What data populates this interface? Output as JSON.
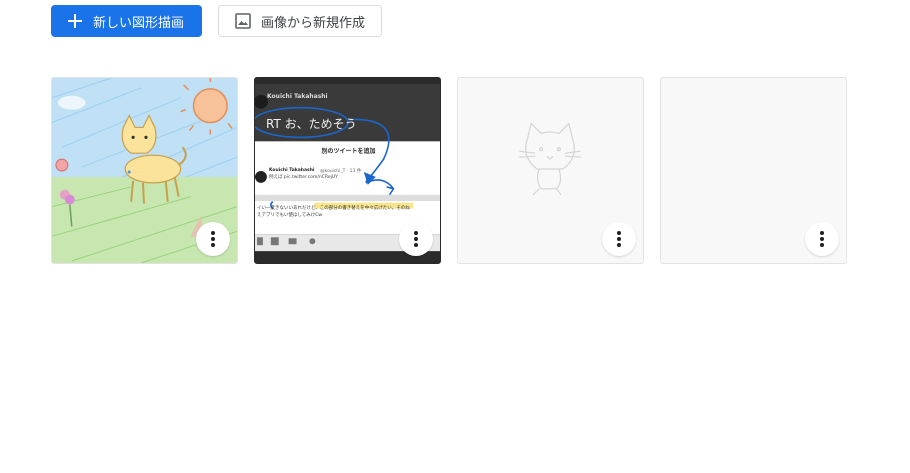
{
  "toolbar": {
    "new_drawing_label": "新しい図形描画",
    "new_from_image_label": "画像から新規作成"
  },
  "drawings": [
    {
      "kind": "crayon-cat-sketch"
    },
    {
      "kind": "tweet-screenshot-annotation",
      "tweet_author": "Kouichi Takahashi",
      "tweet_text": "RT お、ためそう",
      "dialog_title": "別のツイートを追加",
      "reply_author": "Kouichi Takahashi",
      "reply_handle": "@kouichi_T · 13 件",
      "reply_text": "例えば pic.twitter.com/nCRejUY",
      "body_text_1": "イい一度きないいあれだけど、この部分の書き替えを中々広げたい。そのね",
      "body_text_2": "えアプリでもい使ほしてみけCw"
    },
    {
      "kind": "faint-cat-sketch"
    },
    {
      "kind": "blank"
    }
  ],
  "colors": {
    "primary": "#1a73e8",
    "border": "#dadce0",
    "annotation_blue": "#1a66cc"
  }
}
